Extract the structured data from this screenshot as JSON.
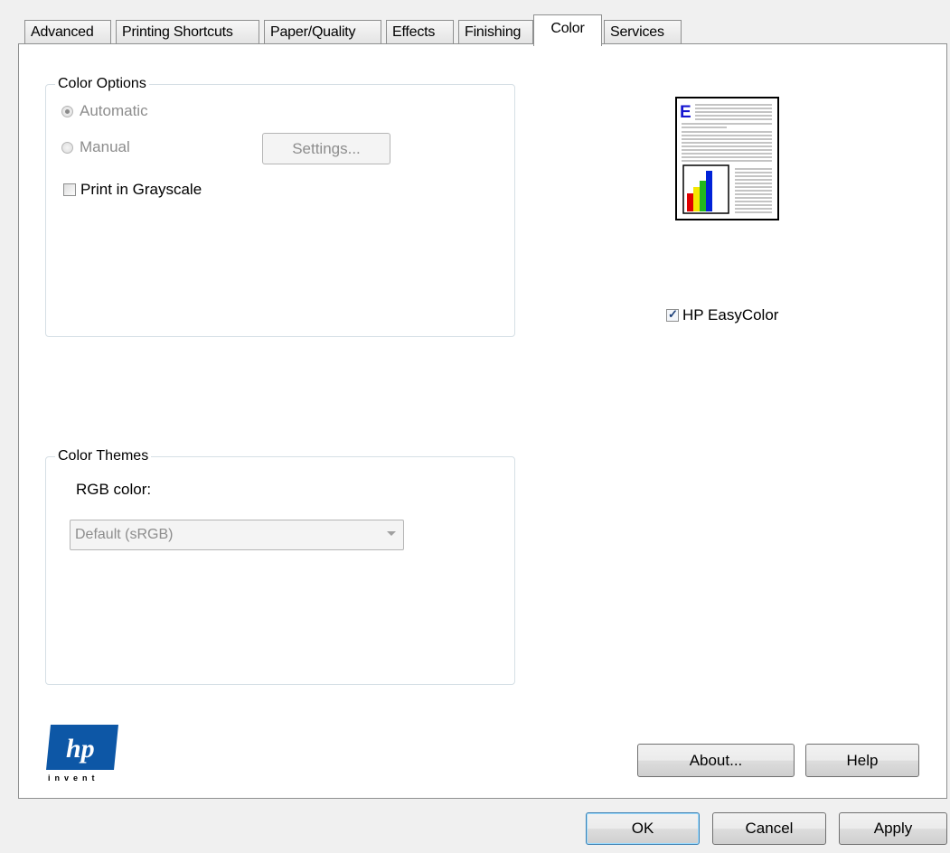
{
  "tabs": [
    {
      "label": "Advanced"
    },
    {
      "label": "Printing Shortcuts"
    },
    {
      "label": "Paper/Quality"
    },
    {
      "label": "Effects"
    },
    {
      "label": "Finishing"
    },
    {
      "label": "Color"
    },
    {
      "label": "Services"
    }
  ],
  "active_tab": "Color",
  "color_options": {
    "legend": "Color Options",
    "automatic_label": "Automatic",
    "automatic_selected": true,
    "manual_label": "Manual",
    "manual_selected": false,
    "settings_button": "Settings...",
    "grayscale_label": "Print in Grayscale",
    "grayscale_checked": false
  },
  "easycolor": {
    "label": "HP EasyColor",
    "checked": true
  },
  "preview": {
    "letter": "E",
    "bar_colors": [
      "#e00000",
      "#f5e600",
      "#22b81e",
      "#0022d8"
    ]
  },
  "color_themes": {
    "legend": "Color Themes",
    "rgb_label": "RGB color:",
    "rgb_value": "Default (sRGB)"
  },
  "logo": {
    "text": "invent"
  },
  "buttons": {
    "about": "About...",
    "help": "Help",
    "ok": "OK",
    "cancel": "Cancel",
    "apply": "Apply"
  }
}
